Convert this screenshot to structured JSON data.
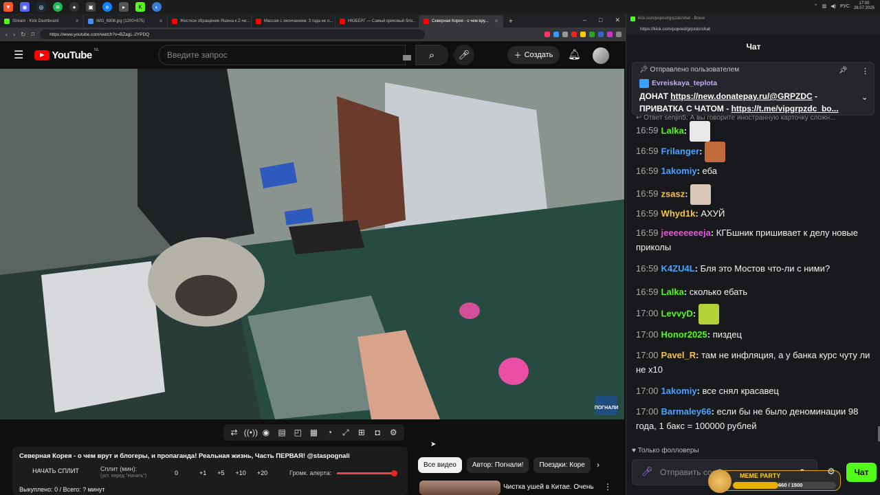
{
  "taskbar": {
    "icons": [
      "brave",
      "discord",
      "steam",
      "spotify",
      "obs",
      "app",
      "edge",
      "folder",
      "kick",
      "chrome"
    ],
    "tray": {
      "lang": "РУС",
      "time": "17:00",
      "date": "28.07.2025"
    }
  },
  "browser": {
    "tabs": [
      {
        "label": "Stream - Kick Dashboard",
        "color": "#53fc18"
      },
      {
        "label": "IMG_6908.jpg (1200×675)",
        "color": "#4a8cf7"
      },
      {
        "label": "Жесткое обращение Яшина к Z-чи...",
        "color": "#ff0000"
      },
      {
        "label": "Массаж с окончанием: 3 года не л...",
        "color": "#ff0000"
      },
      {
        "label": "НЮБЕРГ — Самый криковый бло...",
        "color": "#ff0000"
      },
      {
        "label": "Северная Корея - о чем вру...",
        "color": "#ff0000"
      }
    ],
    "new_tab": "+",
    "window_controls": [
      "–",
      "□",
      "✕"
    ],
    "url": "https://www.youtube.com/watch?v=BZagL-2YPDQ"
  },
  "youtube": {
    "logo": "YouTube",
    "region": "NL",
    "search_placeholder": "Введите запрос",
    "create_label": "Создать",
    "channel_watermark": "ПОГНАЛИ",
    "panel": {
      "title": "Северная Корея - о чем врут и блогеры, и пропаганда! Реальная жизнь, Часть ПЕРВАЯ! @staspognali",
      "split_button": "НАЧАТЬ СПЛИТ",
      "split_label": "Сплит (мин):",
      "split_sub": "(уст. перед \"Начать\")",
      "split_value": "0",
      "increments": [
        "+1",
        "+5",
        "+10",
        "+20"
      ],
      "volume_label": "Громк. алерта:",
      "volume_level": 0.95,
      "bought": "Выкуплено: 0 / Всего: ? минут"
    },
    "chips": [
      "Все видео",
      "Автор: Погнали!",
      "Поездки: Коре"
    ],
    "recommendation": {
      "title": "Чистка ушей в Китае. Очень"
    }
  },
  "chat": {
    "window_title": "kick.com/popout/grpzdc/chat - Brave",
    "url": "https://kick.com/popout/grpzdc/chat",
    "header": "Чат",
    "pinned": {
      "by": "Отправлено пользователем",
      "user": "Evreiskaya_teplota",
      "line1": "ДОНАТ",
      "link1": "https://new.donatepay.ru/@GRPZDC",
      "line1_tail": "-",
      "line2": "ПРИВАТКА С ЧАТОМ -",
      "link2": "https://t.me/vipgrpzdc_bo..."
    },
    "reply_hint": "Ответ senjin5: А вы говорите иностранную карточку сложн...",
    "messages": [
      {
        "time": "16:59",
        "user": "Lalka",
        "color": "#53fc18",
        "text": "",
        "emote": "#e8e8e8"
      },
      {
        "time": "16:59",
        "user": "Frilanger",
        "color": "#4aa3ff",
        "text": "",
        "emote": "#c26a3a"
      },
      {
        "time": "16:59",
        "user": "1akomiy",
        "color": "#4aa3ff",
        "text": "еба",
        "emote": ""
      },
      {
        "time": "16:59",
        "user": "zsasz",
        "color": "#f5c542",
        "text": "",
        "emote": "#d9c8b8"
      },
      {
        "time": "16:59",
        "user": "Whyd1k",
        "color": "#f5c542",
        "text": "АХУЙ",
        "emote": ""
      },
      {
        "time": "16:59",
        "user": "jeeeeeeeeja",
        "color": "#e35bd8",
        "text": "КГБшник пришивает к делу новые приколы",
        "emote": ""
      },
      {
        "time": "16:59",
        "user": "K4ZU4L",
        "color": "#4aa3ff",
        "text": "Бля это Мостов что-ли с ними?",
        "emote": ""
      },
      {
        "time": "16:59",
        "user": "Lalka",
        "color": "#53fc18",
        "text": "сколько ебать",
        "emote": ""
      },
      {
        "time": "17:00",
        "user": "LevvyD",
        "color": "#53fc18",
        "text": "",
        "emote": "#b4d33a"
      },
      {
        "time": "17:00",
        "user": "Honor2025",
        "color": "#53fc18",
        "text": "пиздец",
        "emote": ""
      },
      {
        "time": "17:00",
        "user": "Pavel_R",
        "color": "#f5c542",
        "text": "там не инфляция, а у банка курс чуту ли не х10",
        "emote": ""
      },
      {
        "time": "17:00",
        "user": "1akomiy",
        "color": "#4aa3ff",
        "text": "все снял красавец",
        "emote": ""
      },
      {
        "time": "17:00",
        "user": "Barmaley66",
        "color": "#4aa3ff",
        "text": "если бы не было деноминации 98 года, 1 бакс = 100000 рублей",
        "emote": ""
      }
    ],
    "followers_only": "Только фолловеры",
    "input_placeholder": "Отправить сообщение",
    "send_label": "Чат",
    "meme_party": {
      "title": "MEME PARTY",
      "count": "660 / 1500",
      "progress": 0.44
    }
  }
}
